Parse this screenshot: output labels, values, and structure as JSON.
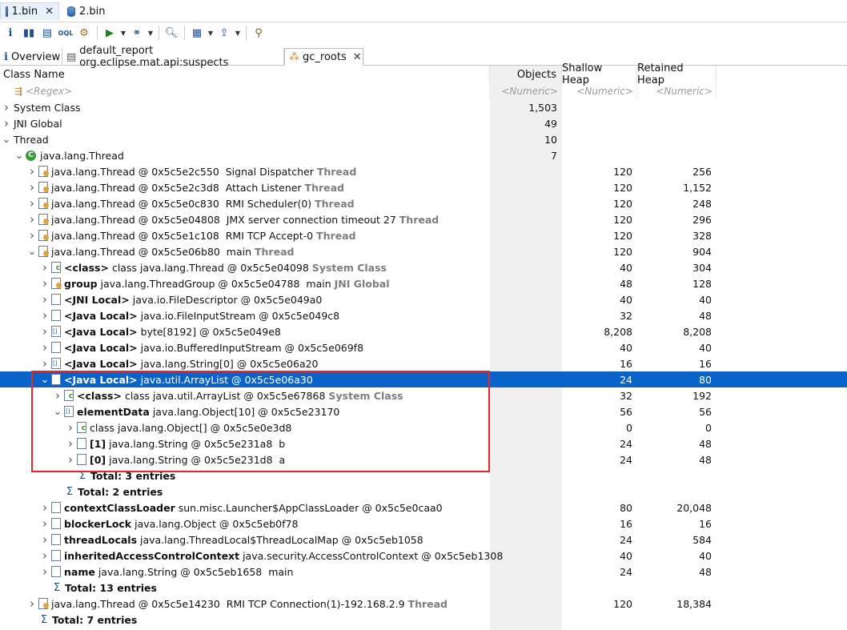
{
  "editor_tabs": [
    {
      "label": "1.bin",
      "active": true
    },
    {
      "label": "2.bin",
      "active": false
    }
  ],
  "toolbar": {
    "icons": [
      "info-icon",
      "histogram-icon",
      "dominator-tree-icon",
      "oql-icon",
      "heap-dump-overview-icon",
      "query-browser-icon",
      "group-by-icon",
      "search-icon",
      "calculate-retained-size-icon",
      "export-icon",
      "pin-icon"
    ]
  },
  "view_tabs": [
    {
      "label": "Overview"
    },
    {
      "label": "default_report org.eclipse.mat.api:suspects"
    },
    {
      "label": "gc_roots",
      "active": true
    }
  ],
  "columns": {
    "class_name": "Class Name",
    "objects": "Objects",
    "shallow": "Shallow Heap",
    "retained": "Retained Heap"
  },
  "filter": {
    "name": "<Regex>",
    "objects": "<Numeric>",
    "shallow": "<Numeric>",
    "retained": "<Numeric>"
  },
  "rows": [
    {
      "indent": 0,
      "arrow": ">",
      "icon": "none",
      "parts": [
        [
          "",
          "System Class"
        ]
      ],
      "objects": "1,503",
      "shallow": "",
      "retained": ""
    },
    {
      "indent": 0,
      "arrow": ">",
      "icon": "none",
      "parts": [
        [
          "",
          "JNI Global"
        ]
      ],
      "objects": "49",
      "shallow": "",
      "retained": ""
    },
    {
      "indent": 0,
      "arrow": "v",
      "icon": "none",
      "parts": [
        [
          "",
          "Thread"
        ]
      ],
      "objects": "10",
      "shallow": "",
      "retained": ""
    },
    {
      "indent": 1,
      "arrow": "v",
      "icon": "classc",
      "parts": [
        [
          "",
          "java.lang.Thread"
        ]
      ],
      "objects": "7",
      "shallow": "",
      "retained": ""
    },
    {
      "indent": 2,
      "arrow": ">",
      "icon": "thread",
      "parts": [
        [
          "",
          "java.lang.Thread @ 0x5c5e2c550  Signal Dispatcher "
        ],
        [
          "gray",
          "Thread"
        ]
      ],
      "objects": "",
      "shallow": "120",
      "retained": "256"
    },
    {
      "indent": 2,
      "arrow": ">",
      "icon": "thread",
      "parts": [
        [
          "",
          "java.lang.Thread @ 0x5c5e2c3d8  Attach Listener "
        ],
        [
          "gray",
          "Thread"
        ]
      ],
      "objects": "",
      "shallow": "120",
      "retained": "1,152"
    },
    {
      "indent": 2,
      "arrow": ">",
      "icon": "thread",
      "parts": [
        [
          "",
          "java.lang.Thread @ 0x5c5e0c830  RMI Scheduler(0) "
        ],
        [
          "gray",
          "Thread"
        ]
      ],
      "objects": "",
      "shallow": "120",
      "retained": "248"
    },
    {
      "indent": 2,
      "arrow": ">",
      "icon": "thread",
      "parts": [
        [
          "",
          "java.lang.Thread @ 0x5c5e04808  JMX server connection timeout 27 "
        ],
        [
          "gray",
          "Thread"
        ]
      ],
      "objects": "",
      "shallow": "120",
      "retained": "296"
    },
    {
      "indent": 2,
      "arrow": ">",
      "icon": "thread",
      "parts": [
        [
          "",
          "java.lang.Thread @ 0x5c5e1c108  RMI TCP Accept-0 "
        ],
        [
          "gray",
          "Thread"
        ]
      ],
      "objects": "",
      "shallow": "120",
      "retained": "328"
    },
    {
      "indent": 2,
      "arrow": "v",
      "icon": "thread",
      "parts": [
        [
          "",
          "java.lang.Thread @ 0x5c5e06b80  main "
        ],
        [
          "gray",
          "Thread"
        ]
      ],
      "objects": "",
      "shallow": "120",
      "retained": "904"
    },
    {
      "indent": 3,
      "arrow": ">",
      "icon": "cls",
      "parts": [
        [
          "bold",
          "<class>"
        ],
        [
          "",
          " class java.lang.Thread @ 0x5c5e04098 "
        ],
        [
          "gray",
          "System Class"
        ]
      ],
      "objects": "",
      "shallow": "40",
      "retained": "304"
    },
    {
      "indent": 3,
      "arrow": ">",
      "icon": "thread",
      "parts": [
        [
          "bold",
          "group"
        ],
        [
          "",
          " java.lang.ThreadGroup @ 0x5c5e04788  main "
        ],
        [
          "gray",
          "JNI Global"
        ]
      ],
      "objects": "",
      "shallow": "48",
      "retained": "128"
    },
    {
      "indent": 3,
      "arrow": ">",
      "icon": "obj",
      "parts": [
        [
          "bold",
          "<JNI Local>"
        ],
        [
          "",
          " java.io.FileDescriptor @ 0x5c5e049a0"
        ]
      ],
      "objects": "",
      "shallow": "40",
      "retained": "40"
    },
    {
      "indent": 3,
      "arrow": ">",
      "icon": "obj",
      "parts": [
        [
          "bold",
          "<Java Local>"
        ],
        [
          "",
          " java.io.FileInputStream @ 0x5c5e049c8"
        ]
      ],
      "objects": "",
      "shallow": "32",
      "retained": "48"
    },
    {
      "indent": 3,
      "arrow": ">",
      "icon": "arr",
      "parts": [
        [
          "bold",
          "<Java Local>"
        ],
        [
          "",
          " byte[8192] @ 0x5c5e049e8"
        ]
      ],
      "objects": "",
      "shallow": "8,208",
      "retained": "8,208"
    },
    {
      "indent": 3,
      "arrow": ">",
      "icon": "obj",
      "parts": [
        [
          "bold",
          "<Java Local>"
        ],
        [
          "",
          " java.io.BufferedInputStream @ 0x5c5e069f8"
        ]
      ],
      "objects": "",
      "shallow": "40",
      "retained": "40"
    },
    {
      "indent": 3,
      "arrow": ">",
      "icon": "arr",
      "parts": [
        [
          "bold",
          "<Java Local>"
        ],
        [
          "",
          " java.lang.String[0] @ 0x5c5e06a20"
        ]
      ],
      "objects": "",
      "shallow": "16",
      "retained": "16"
    },
    {
      "indent": 3,
      "arrow": "v",
      "icon": "obj",
      "sel": true,
      "parts": [
        [
          "bold",
          "<Java Local>"
        ],
        [
          "",
          " java.util.ArrayList @ 0x5c5e06a30"
        ]
      ],
      "objects": "",
      "shallow": "24",
      "retained": "80"
    },
    {
      "indent": 4,
      "arrow": ">",
      "icon": "cls",
      "parts": [
        [
          "bold",
          "<class>"
        ],
        [
          "",
          " class java.util.ArrayList @ 0x5c5e67868 "
        ],
        [
          "gray",
          "System Class"
        ]
      ],
      "objects": "",
      "shallow": "32",
      "retained": "192"
    },
    {
      "indent": 4,
      "arrow": "v",
      "icon": "arr",
      "parts": [
        [
          "bold",
          "elementData"
        ],
        [
          "",
          " java.lang.Object[10] @ 0x5c5e23170"
        ]
      ],
      "objects": "",
      "shallow": "56",
      "retained": "56"
    },
    {
      "indent": 5,
      "arrow": ">",
      "icon": "cls",
      "parts": [
        [
          "",
          "class java.lang.Object[] @ 0x5c5e0e3d8"
        ]
      ],
      "objects": "",
      "shallow": "0",
      "retained": "0"
    },
    {
      "indent": 5,
      "arrow": ">",
      "icon": "obj",
      "parts": [
        [
          "bold",
          "[1]"
        ],
        [
          "",
          " java.lang.String @ 0x5c5e231a8  b"
        ]
      ],
      "objects": "",
      "shallow": "24",
      "retained": "48"
    },
    {
      "indent": 5,
      "arrow": ">",
      "icon": "obj",
      "parts": [
        [
          "bold",
          "[0]"
        ],
        [
          "",
          " java.lang.String @ 0x5c5e231d8  a"
        ]
      ],
      "objects": "",
      "shallow": "24",
      "retained": "48"
    },
    {
      "indent": 5,
      "arrow": "",
      "icon": "sigma",
      "parts": [
        [
          "bold",
          "Total: 3 entries"
        ]
      ],
      "objects": "",
      "shallow": "",
      "retained": ""
    },
    {
      "indent": 4,
      "arrow": "",
      "icon": "sigma",
      "parts": [
        [
          "bold",
          "Total: 2 entries"
        ]
      ],
      "objects": "",
      "shallow": "",
      "retained": ""
    },
    {
      "indent": 3,
      "arrow": ">",
      "icon": "obj",
      "parts": [
        [
          "bold",
          "contextClassLoader"
        ],
        [
          "",
          " sun.misc.Launcher$AppClassLoader @ 0x5c5e0caa0"
        ]
      ],
      "objects": "",
      "shallow": "80",
      "retained": "20,048"
    },
    {
      "indent": 3,
      "arrow": ">",
      "icon": "obj",
      "parts": [
        [
          "bold",
          "blockerLock"
        ],
        [
          "",
          " java.lang.Object @ 0x5c5eb0f78"
        ]
      ],
      "objects": "",
      "shallow": "16",
      "retained": "16"
    },
    {
      "indent": 3,
      "arrow": ">",
      "icon": "obj",
      "parts": [
        [
          "bold",
          "threadLocals"
        ],
        [
          "",
          " java.lang.ThreadLocal$ThreadLocalMap @ 0x5c5eb1058"
        ]
      ],
      "objects": "",
      "shallow": "24",
      "retained": "584"
    },
    {
      "indent": 3,
      "arrow": ">",
      "icon": "obj",
      "parts": [
        [
          "bold",
          "inheritedAccessControlContext"
        ],
        [
          "",
          " java.security.AccessControlContext @ 0x5c5eb1308"
        ]
      ],
      "objects": "",
      "shallow": "40",
      "retained": "40"
    },
    {
      "indent": 3,
      "arrow": ">",
      "icon": "obj",
      "parts": [
        [
          "bold",
          "name"
        ],
        [
          "",
          " java.lang.String @ 0x5c5eb1658  main"
        ]
      ],
      "objects": "",
      "shallow": "24",
      "retained": "48"
    },
    {
      "indent": 3,
      "arrow": "",
      "icon": "sigma",
      "parts": [
        [
          "bold",
          "Total: 13 entries"
        ]
      ],
      "objects": "",
      "shallow": "",
      "retained": ""
    },
    {
      "indent": 2,
      "arrow": ">",
      "icon": "thread",
      "parts": [
        [
          "",
          "java.lang.Thread @ 0x5c5e14230  RMI TCP Connection(1)-192.168.2.9 "
        ],
        [
          "gray",
          "Thread"
        ]
      ],
      "objects": "",
      "shallow": "120",
      "retained": "18,384"
    },
    {
      "indent": 2,
      "arrow": "",
      "icon": "sigma",
      "parts": [
        [
          "bold",
          "Total: 7 entries"
        ]
      ],
      "objects": "",
      "shallow": "",
      "retained": ""
    }
  ]
}
